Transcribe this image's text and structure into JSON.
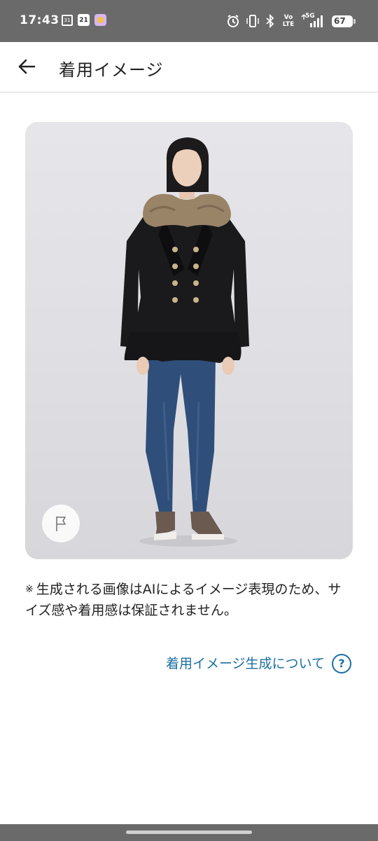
{
  "status_bar": {
    "time": "17:43",
    "calendar_small_day": "31",
    "calendar_day": "21",
    "network": "5G",
    "volte": "Vo LTE",
    "battery": "67",
    "icons": [
      "alarm-icon",
      "vibrate-icon",
      "bluetooth-icon",
      "volte-icon",
      "signal-icon",
      "battery-icon"
    ]
  },
  "header": {
    "back_icon": "arrow-left-icon",
    "title": "着用イメージ"
  },
  "image": {
    "subject": "model wearing black double-breasted peplum coat with fur collar, blue jeans, sneakers",
    "flag_icon": "flag-icon"
  },
  "notice": {
    "mark": "※",
    "text": "生成される画像はAIによるイメージ表現のため、サイズ感や着用感は保証されません。"
  },
  "about_link": {
    "label": "着用イメージ生成について",
    "icon": "help-circle-icon",
    "icon_glyph": "?"
  },
  "colors": {
    "link": "#1a6fa3",
    "status_bar": "#6a6a6a",
    "image_bg": "#e2e2e6"
  }
}
